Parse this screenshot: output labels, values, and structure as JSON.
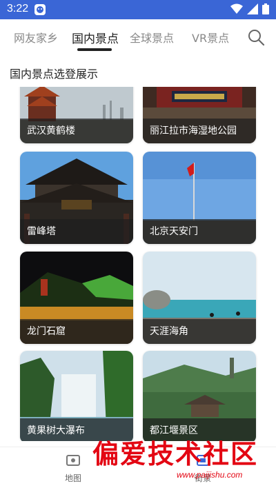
{
  "status_bar": {
    "time": "3:22"
  },
  "tabs": [
    {
      "label": "网友家乡"
    },
    {
      "label": "国内景点"
    },
    {
      "label": "全球景点"
    },
    {
      "label": "VR景点"
    }
  ],
  "section_title": "国内景点选登展示",
  "cards": [
    {
      "caption": "武汉黄鹤楼"
    },
    {
      "caption": "丽江拉市海湿地公园"
    },
    {
      "caption": "雷峰塔"
    },
    {
      "caption": "北京天安门"
    },
    {
      "caption": "龙门石窟"
    },
    {
      "caption": "天涯海角"
    },
    {
      "caption": "黄果树大瀑布"
    },
    {
      "caption": "都江堰景区"
    }
  ],
  "bottom_nav": [
    {
      "label": "地图"
    },
    {
      "label": "街景"
    }
  ],
  "watermark": {
    "text": "偏爱技术社区",
    "url": "www.paijishu.com"
  },
  "colors": {
    "status_bar": "#3a66d6",
    "watermark": "#e30613",
    "tab_active": "#222222",
    "tab_inactive": "#888888"
  }
}
